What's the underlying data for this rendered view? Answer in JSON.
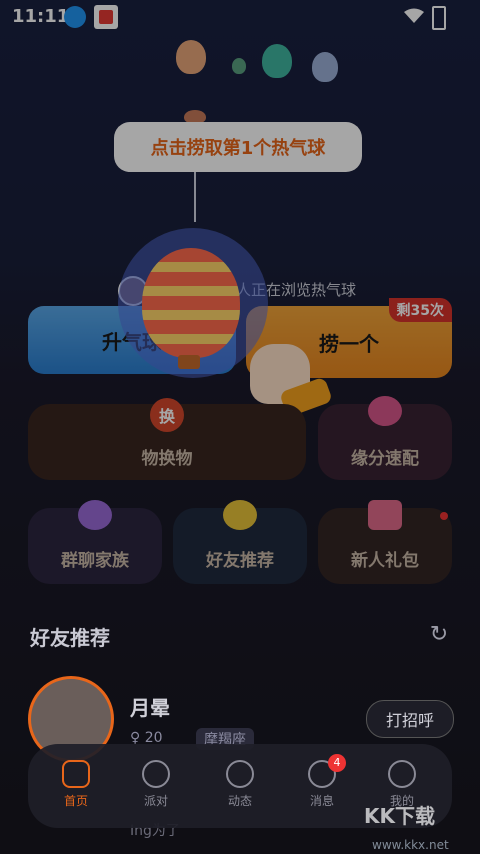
{
  "status_bar": {
    "time": "11:11"
  },
  "tooltip": {
    "text": "点击捞取第1个热气球"
  },
  "browse_hint": {
    "text": "人正在浏览热气球"
  },
  "actions": {
    "rise_label": "升气球",
    "catch_label": "捞一个",
    "remaining_badge": "剩35次"
  },
  "features": {
    "swap_badge": "换",
    "swap_label": "物换物",
    "fate_label": "缘分速配",
    "group_label": "群聊家族",
    "friend_rec_label": "好友推荐",
    "gift_label": "新人礼包"
  },
  "friends_section": {
    "title": "好友推荐",
    "items": [
      {
        "name": "月晕",
        "age": "20",
        "sign": "摩羯座",
        "hello": "打招呼"
      }
    ],
    "next_preview": "Ing为了"
  },
  "nav": {
    "items": [
      {
        "label": "首页"
      },
      {
        "label": "派对"
      },
      {
        "label": "动态"
      },
      {
        "label": "消息",
        "badge": "4"
      },
      {
        "label": "我的"
      }
    ]
  },
  "watermark": {
    "main": "KK下载",
    "sub": "www.kkx.net"
  },
  "colors": {
    "accent": "#e8661a",
    "danger": "#d8332c"
  }
}
